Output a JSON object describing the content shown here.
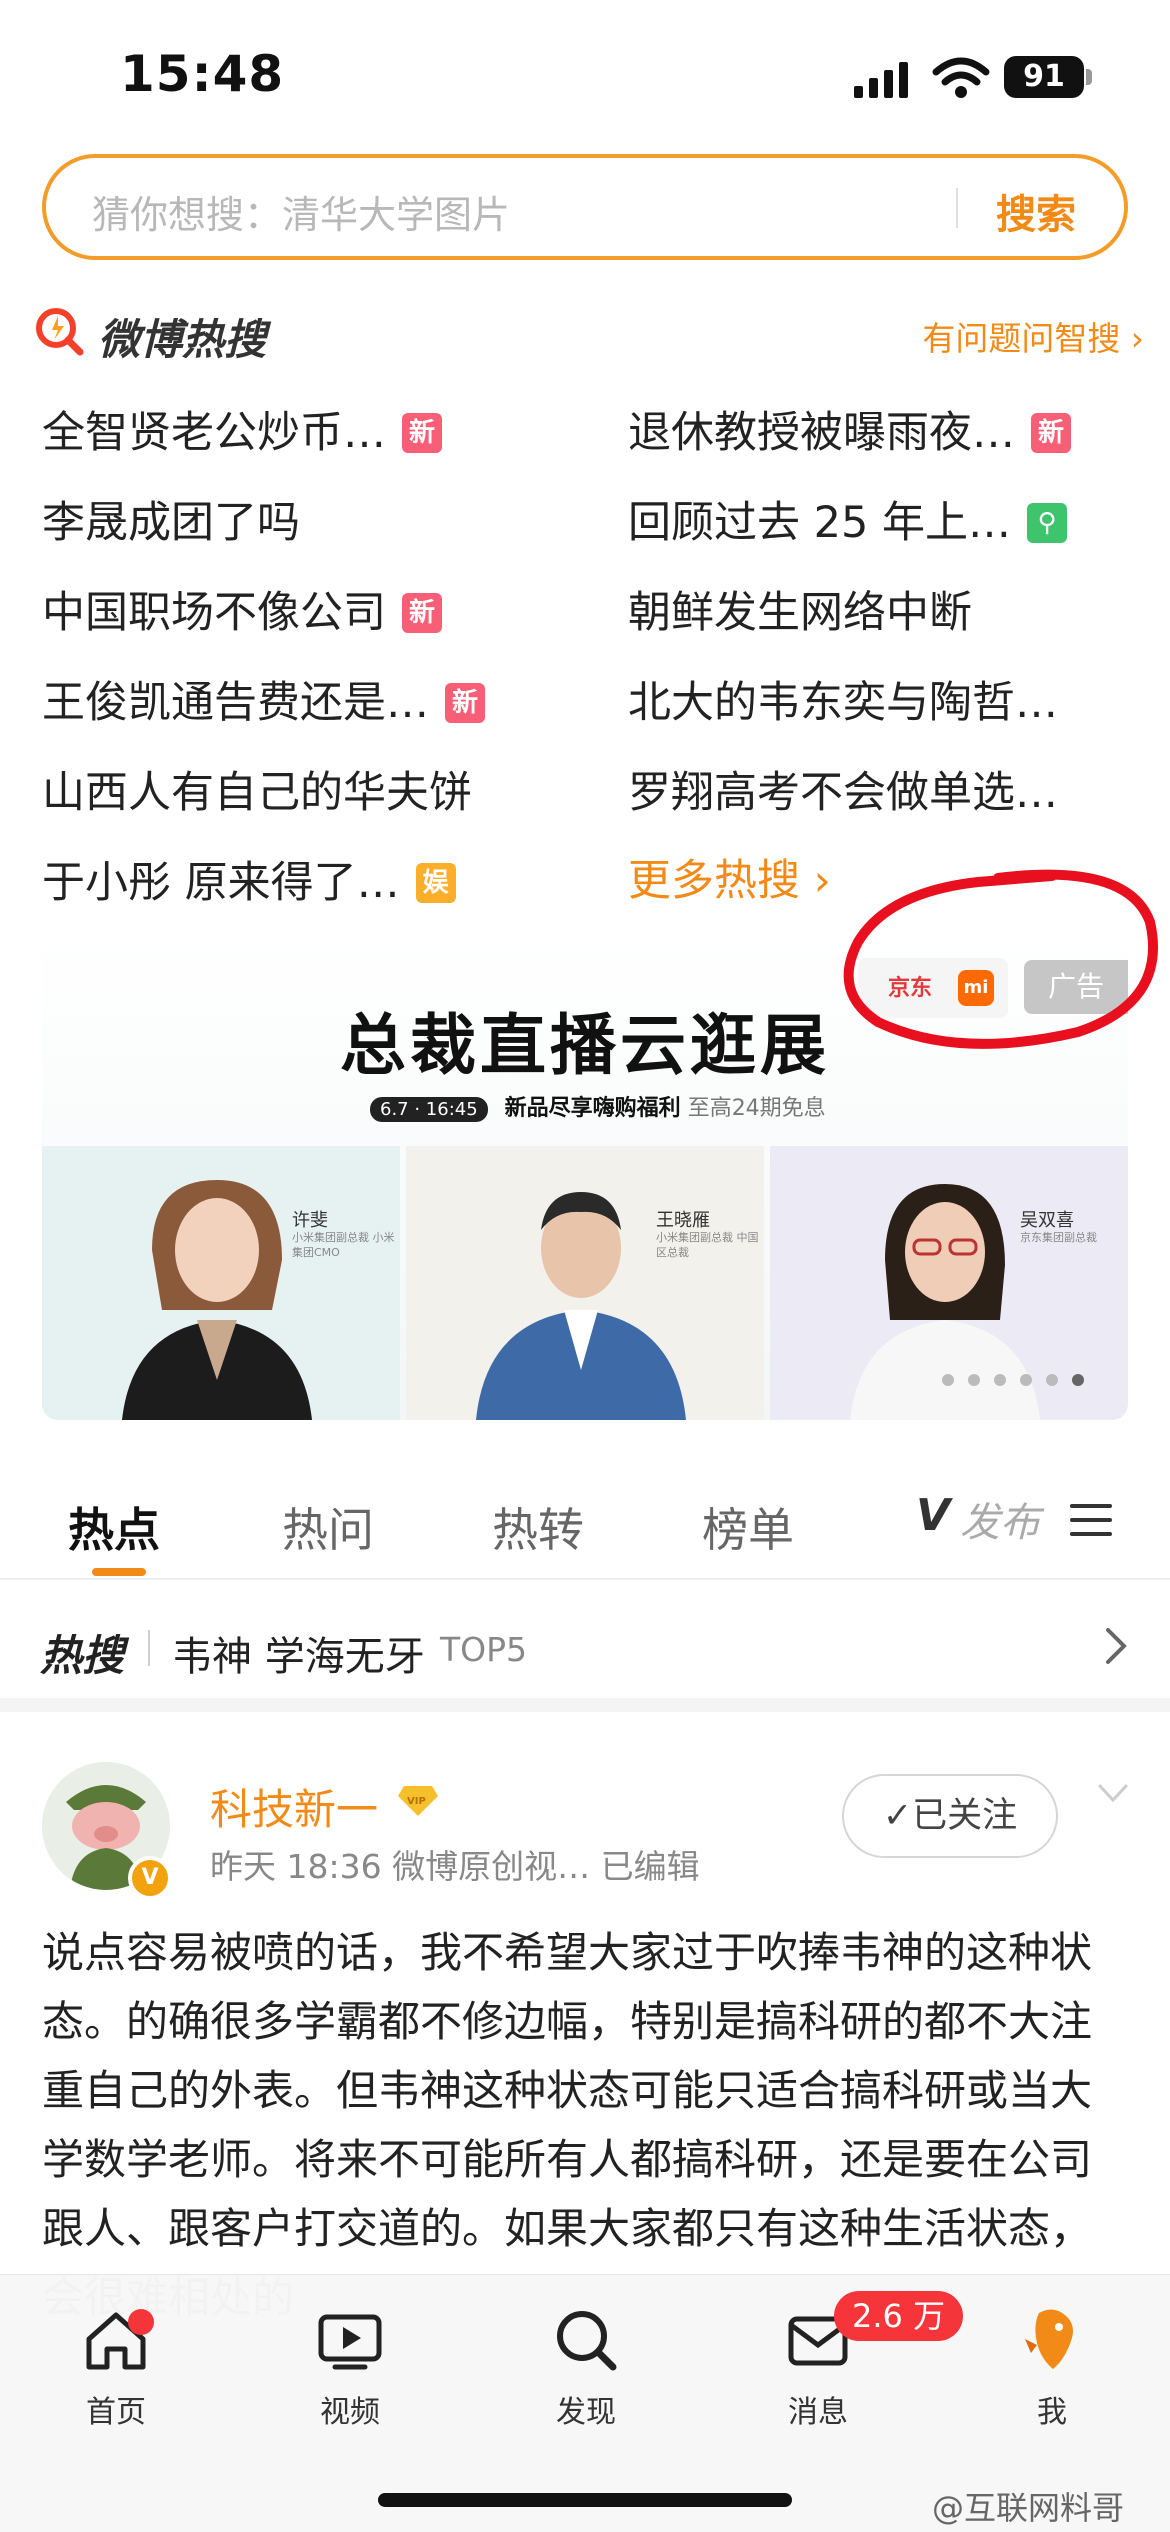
{
  "status_bar": {
    "time": "15:48",
    "battery": "91",
    "icons": [
      "signal-icon",
      "wifi-icon",
      "battery-icon"
    ]
  },
  "search": {
    "placeholder": "猜你想搜：清华大学图片",
    "button": "搜索"
  },
  "hot_header": {
    "logo_text": "微博热搜",
    "ask_link": "有问题问智搜 ›"
  },
  "hot_list": {
    "left": [
      {
        "text": "全智贤老公炒币…",
        "badge": "新",
        "badge_type": "new"
      },
      {
        "text": "李晟成团了吗",
        "badge": "",
        "badge_type": ""
      },
      {
        "text": "中国职场不像公司",
        "badge": "新",
        "badge_type": "new"
      },
      {
        "text": "王俊凯通告费还是…",
        "badge": "新",
        "badge_type": "new"
      },
      {
        "text": "山西人有自己的华夫饼",
        "badge": "",
        "badge_type": ""
      },
      {
        "text": "于小彤 原来得了…",
        "badge": "娱",
        "badge_type": "ent"
      }
    ],
    "right": [
      {
        "text": "退休教授被曝雨夜…",
        "badge": "新",
        "badge_type": "new"
      },
      {
        "text": "回顾过去 25 年上…",
        "badge": "⚲",
        "badge_type": "loc"
      },
      {
        "text": "朝鲜发生网络中断",
        "badge": "",
        "badge_type": ""
      },
      {
        "text": "北大的韦东奕与陶哲…",
        "badge": "",
        "badge_type": ""
      },
      {
        "text": "罗翔高考不会做单选…",
        "badge": "",
        "badge_type": ""
      }
    ],
    "more": "更多热搜 ›"
  },
  "ad": {
    "tag": "广告",
    "brand_jd": "京东",
    "brand_mi": "mi",
    "title": "总裁直播云逛展",
    "date": "6.7 · 16:45",
    "sub_strong": "新品尽享嗨购福利",
    "sub_light": "至高24期免息",
    "people": [
      {
        "name": "许斐",
        "role": "小米集团副总裁 小米集团CMO"
      },
      {
        "name": "王晓雁",
        "role": "小米集团副总裁 中国区总裁"
      },
      {
        "name": "吴双喜",
        "role": "京东集团副总裁"
      }
    ]
  },
  "tabs": {
    "items": [
      "热点",
      "热问",
      "热转",
      "榜单"
    ],
    "active": 0,
    "vlog": "V",
    "vlog_fade": "发布"
  },
  "hot_bar": {
    "logo": "热搜",
    "text": "韦神 学海无牙",
    "rank": "TOP5"
  },
  "post": {
    "author": "科技新一",
    "meta": "昨天 18:36  微博原创视…  已编辑",
    "follow": "✓已关注",
    "body": "说点容易被喷的话，我不希望大家过于吹捧韦神的这种状态。的确很多学霸都不修边幅，特别是搞科研的都不大注重自己的外表。但韦神这种状态可能只适合搞科研或当大学数学老师。将来不可能所有人都搞科研，还是要在公司跟人、跟客户打交道的。如果大家都只有这种生活状态，会很难相处的"
  },
  "bottom_nav": {
    "items": [
      {
        "label": "首页",
        "icon": "home-icon"
      },
      {
        "label": "视频",
        "icon": "video-icon"
      },
      {
        "label": "发现",
        "icon": "discover-icon"
      },
      {
        "label": "消息",
        "icon": "message-icon"
      },
      {
        "label": "我",
        "icon": "profile-icon"
      }
    ],
    "message_badge": "2.6 万",
    "watermark": "@互联网料哥"
  },
  "colors": {
    "accent": "#f28a17",
    "badge_new": "#f85f76",
    "badge_ent": "#fbae2a",
    "badge_loc": "#3ec46d",
    "annotation_red": "#e8101e"
  }
}
